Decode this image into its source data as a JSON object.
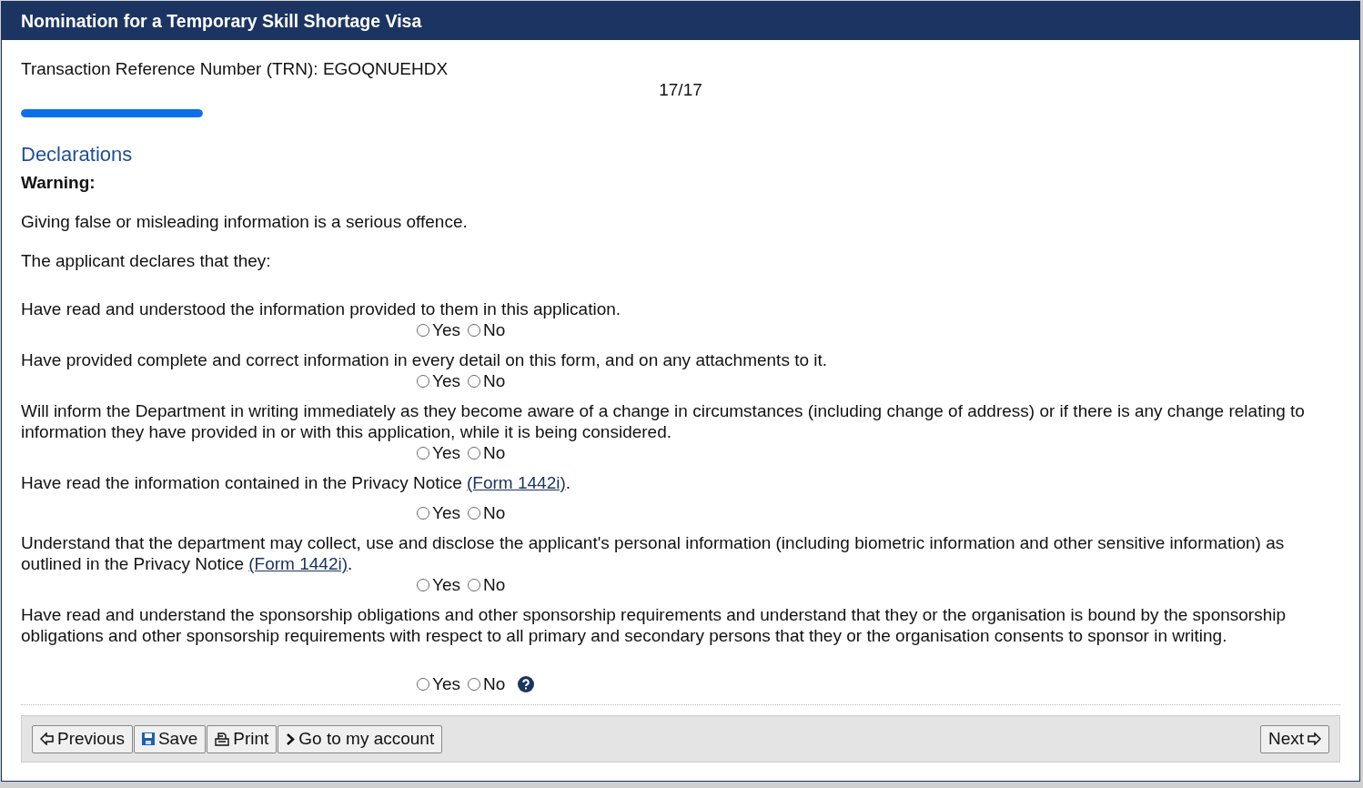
{
  "header": {
    "title": "Nomination for a Temporary Skill Shortage Visa"
  },
  "trn": "Transaction Reference Number (TRN): EGOQNUEHDX",
  "progress": {
    "counter": "17/17",
    "level": 1
  },
  "section": {
    "title": "Declarations",
    "warning_label": "Warning:",
    "warning_text": "Giving false or misleading information is a serious offence.",
    "intro": "The applicant declares that they:"
  },
  "questions": [
    {
      "text": "Have read and understood the information provided to them in this application.",
      "options": [
        {
          "label": "Yes",
          "selected": false
        },
        {
          "label": "No",
          "selected": false
        }
      ],
      "help": false
    },
    {
      "text": "Have provided complete and correct information in every detail on this form, and on any attachments to it.",
      "options": [
        {
          "label": "Yes",
          "selected": false
        },
        {
          "label": "No",
          "selected": false
        }
      ],
      "help": false
    },
    {
      "text": "Will inform the Department in writing immediately as they become aware of a change in circumstances (including change of address) or if there is any change relating to information they have provided in or with this application, while it is being considered.",
      "options": [
        {
          "label": "Yes",
          "selected": false
        },
        {
          "label": "No",
          "selected": false
        }
      ],
      "help": false
    },
    {
      "text": "Have read the information contained in the Privacy Notice ",
      "link": "(Form 1442i)",
      "after": ".",
      "options": [
        {
          "label": "Yes",
          "selected": false
        },
        {
          "label": "No",
          "selected": false
        }
      ],
      "help": false
    },
    {
      "text": "Understand that the department may collect, use and disclose the applicant's personal information (including biometric information and other sensitive information) as outlined in the Privacy Notice ",
      "link": "(Form 1442i)",
      "after": ".",
      "options": [
        {
          "label": "Yes",
          "selected": false
        },
        {
          "label": "No",
          "selected": false
        }
      ],
      "help": false
    },
    {
      "text": "Have read and understand the sponsorship obligations and other sponsorship requirements and understand that they or the organisation is bound by the sponsorship obligations and other sponsorship requirements with respect to all primary and secondary persons that they or the organisation consents to sponsor in writing.",
      "options": [
        {
          "label": "Yes",
          "selected": false
        },
        {
          "label": "No",
          "selected": false
        }
      ],
      "help": true
    }
  ],
  "footer": {
    "buttons": [
      {
        "label": "Previous",
        "kind": "previous"
      },
      {
        "label": "Save",
        "kind": "save"
      },
      {
        "label": "Print",
        "kind": "print"
      },
      {
        "label": "Go to my account",
        "kind": "account"
      }
    ],
    "next": "Next"
  }
}
